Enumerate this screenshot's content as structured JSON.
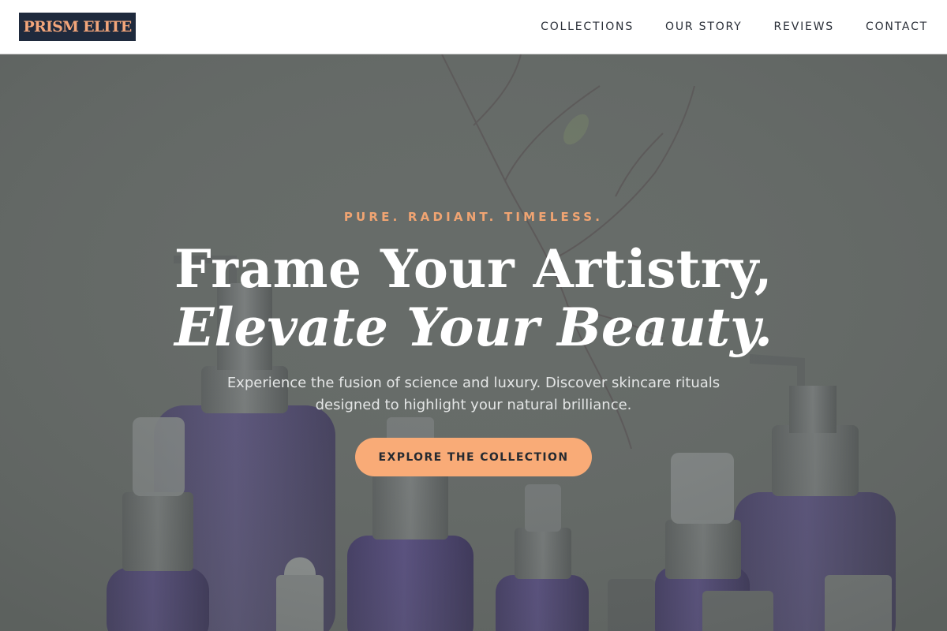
{
  "header": {
    "logo_text": "PRISM ELITE",
    "nav": [
      {
        "label": "COLLECTIONS"
      },
      {
        "label": "OUR STORY"
      },
      {
        "label": "REVIEWS"
      },
      {
        "label": "CONTACT"
      }
    ]
  },
  "hero": {
    "tagline": "PURE. RADIANT. TIMELESS.",
    "headline_line1": "Frame Your Artistry,",
    "headline_line2": "Elevate Your Beauty.",
    "subtitle": "Experience the fusion of science and luxury. Discover skincare rituals designed to highlight your natural brilliance.",
    "cta_label": "EXPLORE THE COLLECTION",
    "background_image_subject": "purple-pump-and-spray-bottles"
  },
  "colors": {
    "logo_bg": "#1f2a3d",
    "accent_peach": "#f9ab77",
    "overlay_grey": "#676c69",
    "bottle_purple": "#4a3f78"
  }
}
